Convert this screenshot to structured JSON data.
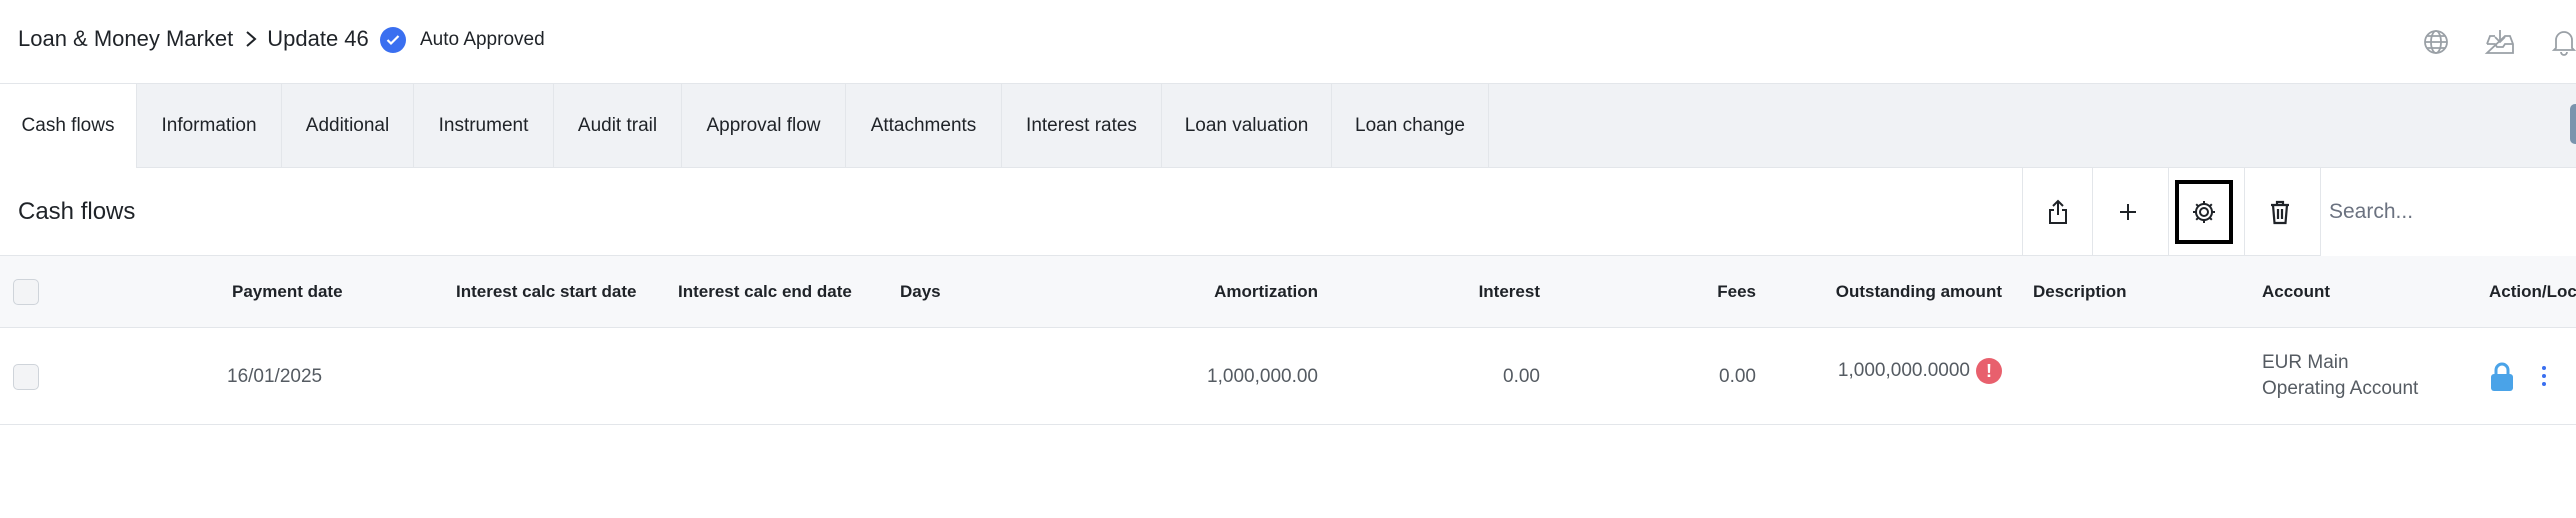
{
  "breadcrumb": {
    "parent": "Loan & Money Market",
    "current": "Update 46"
  },
  "status": {
    "label": "Auto Approved",
    "color": "#3a6ff0"
  },
  "header_icons": [
    "globe-icon",
    "download-tray-icon",
    "bell-icon"
  ],
  "tabs": [
    {
      "label": "Cash flows",
      "active": true
    },
    {
      "label": "Information"
    },
    {
      "label": "Additional"
    },
    {
      "label": "Instrument"
    },
    {
      "label": "Audit trail"
    },
    {
      "label": "Approval flow"
    },
    {
      "label": "Attachments"
    },
    {
      "label": "Interest rates"
    },
    {
      "label": "Loan valuation"
    },
    {
      "label": "Loan change"
    }
  ],
  "section": {
    "title": "Cash flows",
    "toolbar_icons": [
      "share-icon",
      "plus-icon",
      "gear-icon",
      "trash-icon"
    ],
    "search_placeholder": "Search..."
  },
  "table": {
    "columns": {
      "payment_date": "Payment date",
      "interest_start": "Interest calc start date",
      "interest_end": "Interest calc end date",
      "days": "Days",
      "amortization": "Amortization",
      "interest": "Interest",
      "fees": "Fees",
      "outstanding": "Outstanding amount",
      "description": "Description",
      "account": "Account",
      "action": "Action/Lock"
    },
    "rows": [
      {
        "payment_date": "16/01/2025",
        "interest_start": "",
        "interest_end": "",
        "days": "",
        "amortization": "1,000,000.00",
        "interest": "0.00",
        "fees": "0.00",
        "outstanding": "1,000,000.0000",
        "outstanding_flag": "!",
        "description": "",
        "account": "EUR Main Operating Account",
        "locked": true
      }
    ]
  },
  "colors": {
    "accent": "#3a6ff0",
    "warning": "#e8606d",
    "lock": "#4aa3e8"
  }
}
